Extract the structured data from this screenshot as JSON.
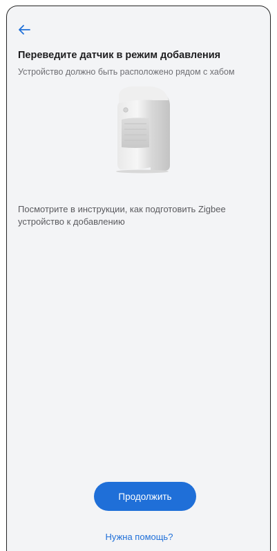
{
  "header": {
    "back_icon": "arrow-left-icon"
  },
  "content": {
    "title": "Переведите датчик в режим добавления",
    "subtitle": "Устройство должно быть расположено рядом с хабом",
    "device_image": "motion-sensor-image",
    "instruction": "Посмотрите в инструкции, как подготовить Zigbee устройство к добавлению"
  },
  "actions": {
    "continue_label": "Продолжить",
    "help_label": "Нужна помощь?"
  },
  "colors": {
    "accent": "#1f6fd8",
    "background": "#f3f4f6",
    "title": "#1d1d1f",
    "secondary_text": "#6e6e73"
  }
}
